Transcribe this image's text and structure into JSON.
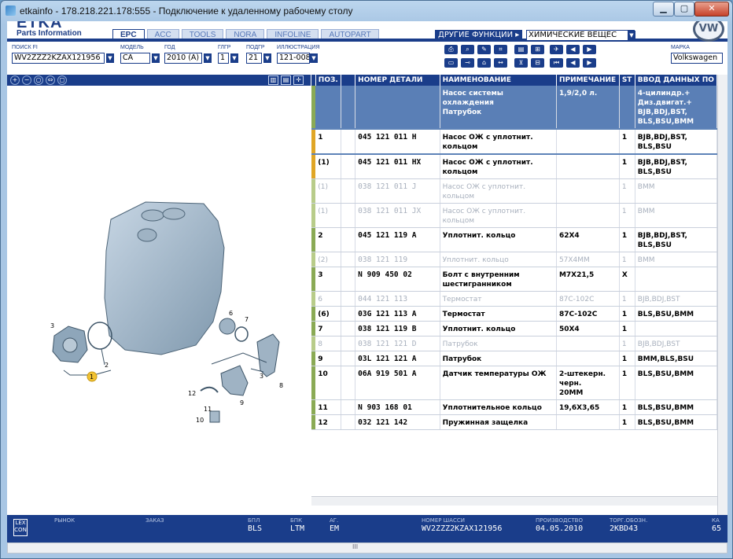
{
  "window": {
    "title": "etkainfo - 178.218.221.178:555 - Подключение к удаленному рабочему столу"
  },
  "brand": {
    "name": "ETKA",
    "subtitle": "Parts Information",
    "vw": "VW"
  },
  "tabs": [
    "EPC",
    "ACC",
    "TOOLS",
    "NORA",
    "INFOLINE",
    "AUTOPART"
  ],
  "other": {
    "label": "ДРУГИЕ ФУНКЦИИ ▸",
    "value": "ХИМИЧЕСКИЕ ВЕЩЕС"
  },
  "fields": {
    "vin_label": "ПОИСК FI",
    "vin": "WV2ZZZ2KZAX121956",
    "model_label": "МОДЕЛЬ",
    "model": "CA",
    "year_label": "ГОД",
    "year": "2010 (A)",
    "mg_label": "ГЛГР",
    "mg": "1",
    "sg_label": "ПОДГР",
    "sg": "21",
    "ill_label": "ИЛЛЮСТРАЦИЯ",
    "ill": "121-008",
    "brand_label": "МАРКА",
    "brand": "Volkswagen"
  },
  "table": {
    "headers": [
      "ПОЗ.",
      "",
      "НОМЕР ДЕТАЛИ",
      "НАИМЕНОВАНИЕ",
      "ПРИМЕЧАНИЕ",
      "ST",
      "ВВОД ДАННЫХ ПО"
    ],
    "rows": [
      {
        "mark": "#8aaa55",
        "pos": "",
        "pn": "",
        "name": "Насос системы охлаждения\nПатрубок",
        "note": "1,9/2,0 л.",
        "st": "",
        "data": "4-цилиндр.+\nДиз.двигат.+\nBJB,BDJ,BST,\nBLS,BSU,BMM",
        "style": "hl"
      },
      {
        "mark": "#e0a626",
        "pos": "1",
        "pn": "045 121 011 H",
        "name": "Насос ОЖ с уплотнит. кольцом",
        "note": "",
        "st": "1",
        "data": "BJB,BDJ,BST,\nBLS,BSU",
        "style": "sel"
      },
      {
        "mark": "#e0a626",
        "pos": "(1)",
        "pn": "045 121 011 HX",
        "name": "Насос ОЖ с уплотнит. кольцом",
        "note": "",
        "st": "1",
        "data": "BJB,BDJ,BST,\nBLS,BSU",
        "style": ""
      },
      {
        "mark": "#b8cc8a",
        "pos": "(1)",
        "pn": "038 121 011 J",
        "name": "Насос ОЖ с уплотнит. кольцом",
        "note": "",
        "st": "1",
        "data": "BMM",
        "style": "dim"
      },
      {
        "mark": "#b8cc8a",
        "pos": "(1)",
        "pn": "038 121 011 JX",
        "name": "Насос ОЖ с уплотнит. кольцом",
        "note": "",
        "st": "1",
        "data": "BMM",
        "style": "dim"
      },
      {
        "mark": "#8aaa55",
        "pos": "2",
        "pn": "045 121 119 A",
        "name": "Уплотнит. кольцо",
        "note": "62X4",
        "st": "1",
        "data": "BJB,BDJ,BST,\nBLS,BSU",
        "style": ""
      },
      {
        "mark": "#b8cc8a",
        "pos": "(2)",
        "pn": "038 121 119",
        "name": "Уплотнит. кольцо",
        "note": "57X4MM",
        "st": "1",
        "data": "BMM",
        "style": "dim"
      },
      {
        "mark": "#8aaa55",
        "pos": "3",
        "pn": "N   909 450 02",
        "name": "Болт с внутренним\nшестигранником",
        "note": "M7X21,5",
        "st": "X",
        "data": "",
        "style": ""
      },
      {
        "mark": "#b8cc8a",
        "pos": "6",
        "pn": "044 121 113",
        "name": "Термостат",
        "note": "87C-102C",
        "st": "1",
        "data": "BJB,BDJ,BST",
        "style": "dim"
      },
      {
        "mark": "#8aaa55",
        "pos": "(6)",
        "pn": "03G 121 113 A",
        "name": "Термостат",
        "note": "87C-102C",
        "st": "1",
        "data": "BLS,BSU,BMM",
        "style": ""
      },
      {
        "mark": "#8aaa55",
        "pos": "7",
        "pn": "038 121 119 B",
        "name": "Уплотнит. кольцо",
        "note": "50X4",
        "st": "1",
        "data": "",
        "style": ""
      },
      {
        "mark": "#b8cc8a",
        "pos": "8",
        "pn": "038 121 121 D",
        "name": "Патрубок",
        "note": "",
        "st": "1",
        "data": "BJB,BDJ,BST",
        "style": "dim"
      },
      {
        "mark": "#8aaa55",
        "pos": "9",
        "pn": "03L 121 121 A",
        "name": "Патрубок",
        "note": "",
        "st": "1",
        "data": "BMM,BLS,BSU",
        "style": ""
      },
      {
        "mark": "#8aaa55",
        "pos": "10",
        "pn": "06A 919 501 A",
        "name": "Датчик температуры ОЖ",
        "note": "2-штекерн.\nчерн.\n20MM",
        "st": "1",
        "data": "BLS,BSU,BMM",
        "style": ""
      },
      {
        "mark": "#8aaa55",
        "pos": "11",
        "pn": "N   903 168 01",
        "name": "Уплотнительное кольцо",
        "note": "19,6X3,65",
        "st": "1",
        "data": "BLS,BSU,BMM",
        "style": ""
      },
      {
        "mark": "#8aaa55",
        "pos": "12",
        "pn": "032 121 142",
        "name": "Пружинная защелка",
        "note": "",
        "st": "1",
        "data": "BLS,BSU,BMM",
        "style": ""
      }
    ]
  },
  "diagram": {
    "callouts": [
      "1",
      "2",
      "3",
      "3",
      "6",
      "7",
      "8",
      "9",
      "10",
      "11",
      "12"
    ]
  },
  "status": {
    "lex": "LEX\nCON",
    "market_label": "РЫНОК",
    "order_label": "ЗАКАЗ",
    "bpl_label": "БПЛ",
    "bpl": "BLS",
    "bpk_label": "БПК",
    "bpk": "LTM",
    "ag_label": "АГ.",
    "ag": "EM",
    "chassis_label": "НОМЕР ШАССИ",
    "chassis": "WV2ZZZ2KZAX121956",
    "prod_label": "ПРОИЗВОДСТВО",
    "prod": "04.05.2010",
    "tpl_label": "ТОРГ.ОБОЗН.",
    "tpl": "2KBD43",
    "ka_label": "КА",
    "ka": "65"
  },
  "scroll": {
    "hs_mark": "III"
  }
}
